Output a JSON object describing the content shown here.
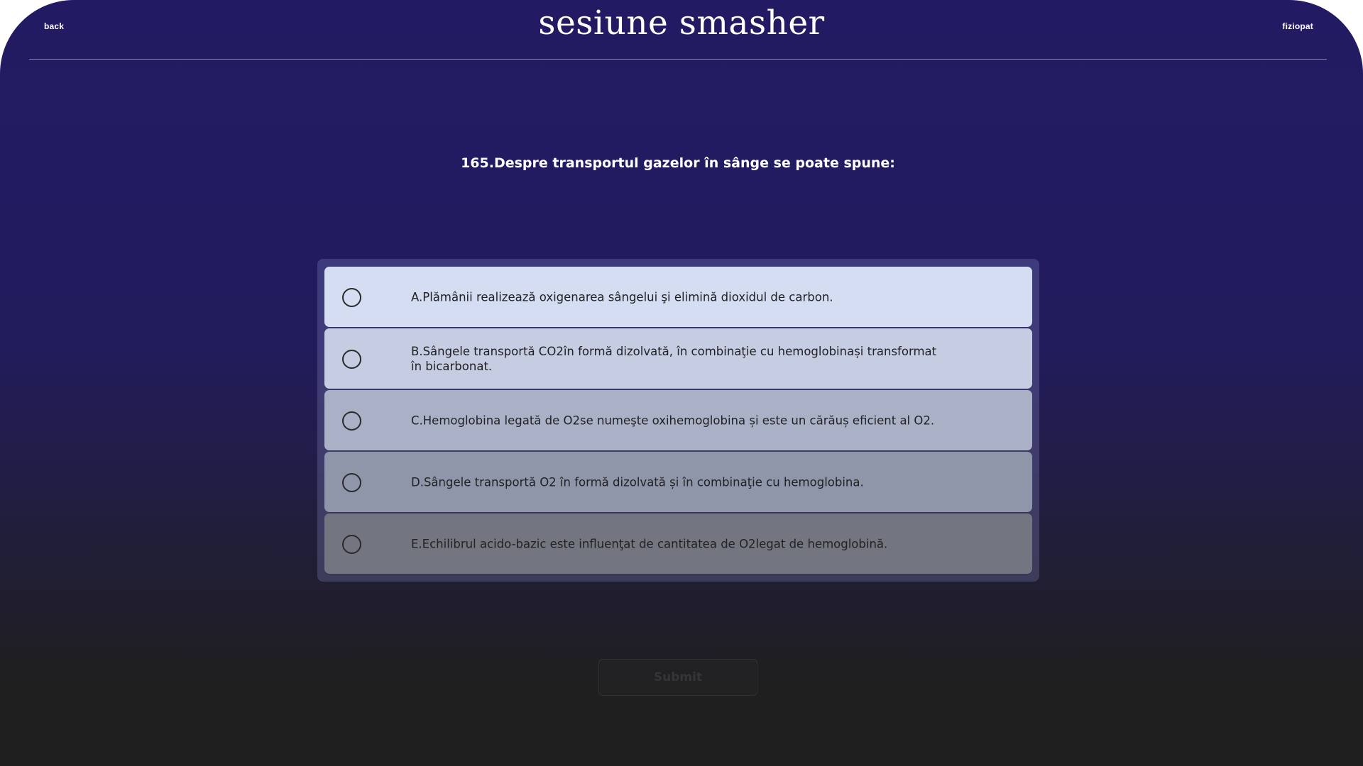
{
  "header": {
    "back_label": "back",
    "title": "sesiune smasher",
    "right_label": "fiziopat"
  },
  "question": {
    "text": "165.Despre transportul gazelor în sânge se poate spune:"
  },
  "options": [
    {
      "text": "A.Plămânii realizează oxigenarea sângelui şi elimină dioxidul de carbon."
    },
    {
      "text": "B.Sângele transportă CO2în formă dizolvată, în combinaţie cu hemoglobinași transformat în bicarbonat."
    },
    {
      "text": "C.Hemoglobina legată de O2se numeşte oxihemoglobina și este un cărăuș eficient al O2."
    },
    {
      "text": "D.Sângele transportă O2 în formă dizolvată și în combinaţie cu hemoglobina."
    },
    {
      "text": "E.Echilibrul acido-bazic este influenţat de cantitatea de O2legat de hemoglobină."
    }
  ],
  "submit": {
    "label": "Submit"
  },
  "colors": {
    "background_top": "#221b63",
    "background_bottom": "#1f1f1f",
    "option_a": "#d5ddf2",
    "option_e": "#737680"
  }
}
